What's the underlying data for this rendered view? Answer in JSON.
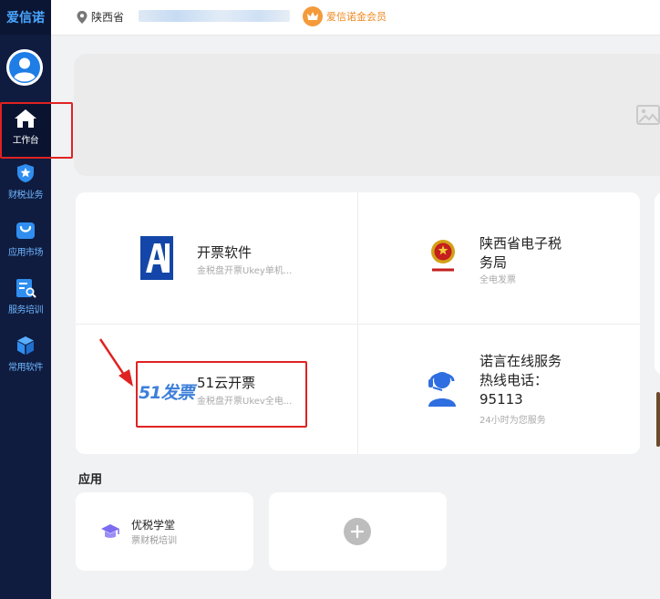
{
  "sidebar": {
    "brand": "爱信诺",
    "items": [
      {
        "label": "工作台",
        "icon": "home-icon"
      },
      {
        "label": "财税业务",
        "icon": "tax-icon"
      },
      {
        "label": "应用市场",
        "icon": "bag-icon"
      },
      {
        "label": "服务培训",
        "icon": "training-icon"
      },
      {
        "label": "常用软件",
        "icon": "cube-icon"
      }
    ]
  },
  "topbar": {
    "location": "陕西省",
    "vip_label": "爱信诺金会员"
  },
  "services": [
    {
      "title": "开票软件",
      "subtitle": "金税盘开票Ukey单机..."
    },
    {
      "title_line1": "陕西省电子税",
      "title_line2": "务局",
      "subtitle": "全电发票"
    },
    {
      "title": "51云开票",
      "subtitle": "金税盘开票Ukev全电...",
      "logo_text": "51发票"
    },
    {
      "title_line1": "诺言在线服务",
      "title_line2": "热线电话：",
      "title_line3": "95113",
      "subtitle": "24小时为您服务"
    }
  ],
  "apps": {
    "title": "应用",
    "items": [
      {
        "name": "优税学堂",
        "subtitle": "票财税培训"
      }
    ]
  },
  "colors": {
    "sidebar_bg": "#0f1c3f",
    "accent": "#4aa6ff",
    "vip": "#f08a24",
    "annotation_red": "#e02222"
  }
}
